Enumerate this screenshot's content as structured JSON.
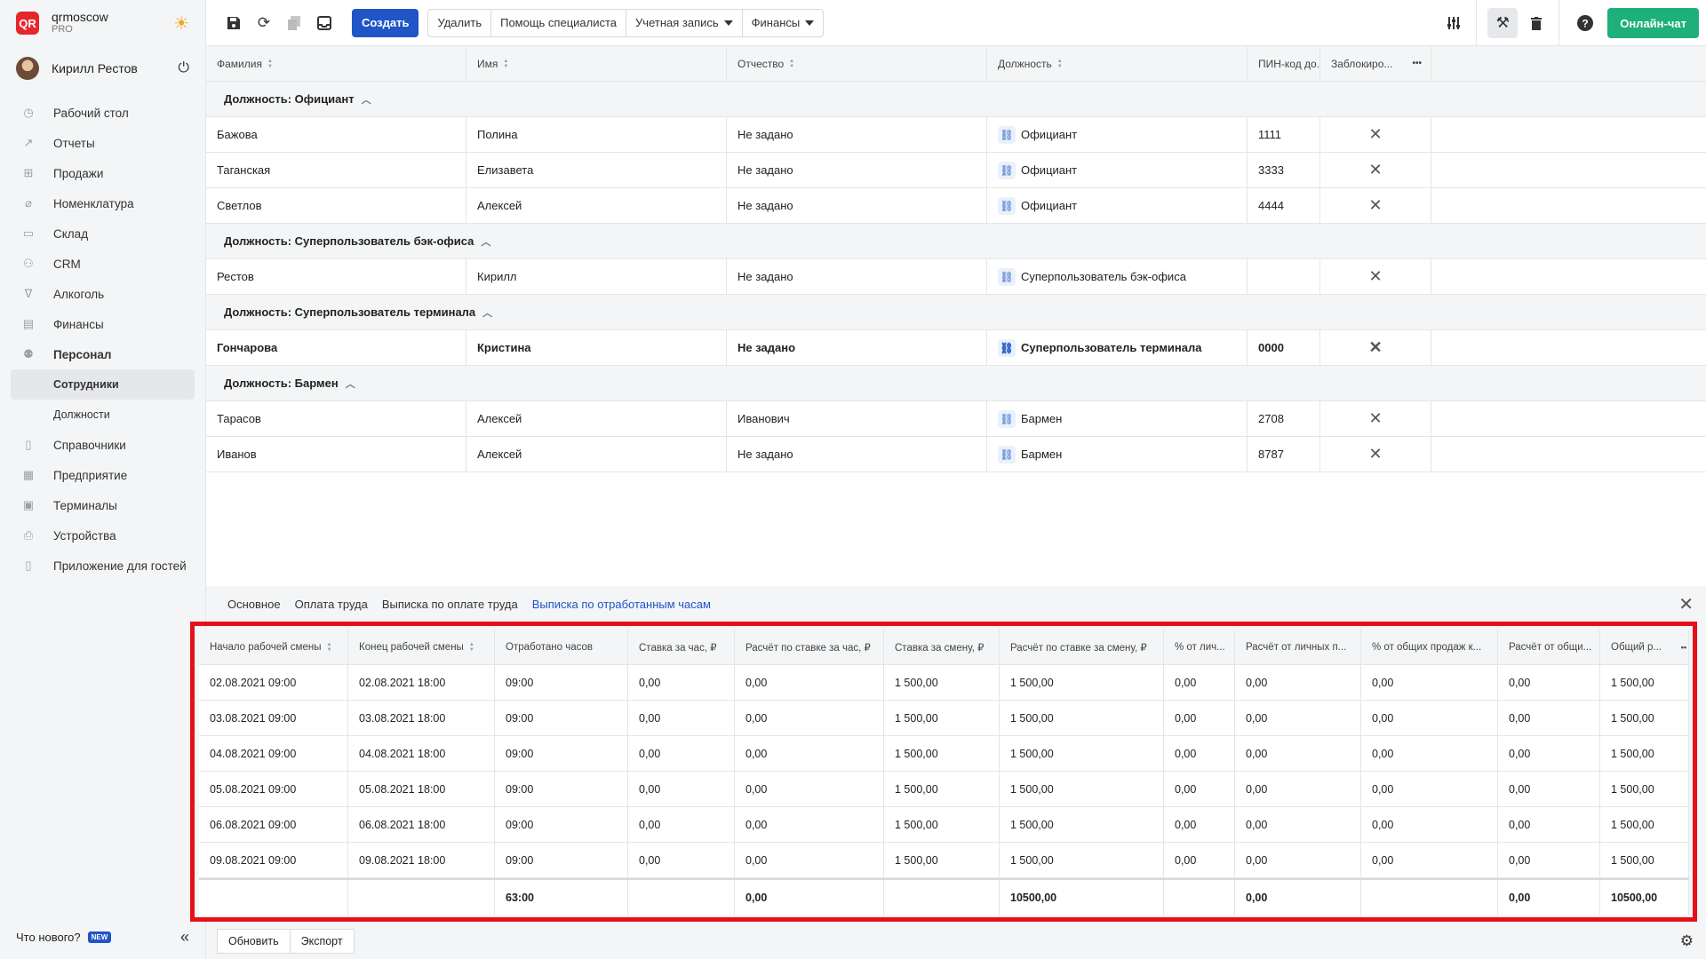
{
  "brand": {
    "name": "qrmoscow",
    "plan": "PRO",
    "logo": "QR"
  },
  "user": {
    "name": "Кирилл Рестов"
  },
  "nav": [
    {
      "label": "Рабочий стол",
      "icon": "dashboard-icon"
    },
    {
      "label": "Отчеты",
      "icon": "chart-icon"
    },
    {
      "label": "Продажи",
      "icon": "basket-icon"
    },
    {
      "label": "Номенклатура",
      "icon": "tag-icon"
    },
    {
      "label": "Склад",
      "icon": "box-icon"
    },
    {
      "label": "CRM",
      "icon": "users-icon"
    },
    {
      "label": "Алкоголь",
      "icon": "glass-icon"
    },
    {
      "label": "Финансы",
      "icon": "wallet-icon"
    },
    {
      "label": "Персонал",
      "icon": "people-icon"
    }
  ],
  "nav_sub": [
    "Сотрудники",
    "Должности"
  ],
  "nav_after": [
    {
      "label": "Справочники",
      "icon": "book-icon"
    },
    {
      "label": "Предприятие",
      "icon": "building-icon"
    },
    {
      "label": "Терминалы",
      "icon": "terminal-icon"
    },
    {
      "label": "Устройства",
      "icon": "printer-icon"
    },
    {
      "label": "Приложение для гостей",
      "icon": "phone-icon"
    }
  ],
  "sidebar_footer": {
    "whats_new": "Что нового?",
    "badge": "NEW"
  },
  "toolbar": {
    "create": "Создать",
    "delete": "Удалить",
    "help": "Помощь специалиста",
    "account": "Учетная запись",
    "finance": "Финансы",
    "chat": "Онлайн-чат"
  },
  "main_columns": [
    "Фамилия",
    "Имя",
    "Отчество",
    "Должность",
    "ПИН-код до...",
    "Заблокиро..."
  ],
  "groups": [
    {
      "title": "Должность: Официант",
      "rows": [
        {
          "last": "Бажова",
          "first": "Полина",
          "middle": "Не задано",
          "role": "Официант",
          "pin": "1111"
        },
        {
          "last": "Таганская",
          "first": "Елизавета",
          "middle": "Не задано",
          "role": "Официант",
          "pin": "3333"
        },
        {
          "last": "Светлов",
          "first": "Алексей",
          "middle": "Не задано",
          "role": "Официант",
          "pin": "4444"
        }
      ]
    },
    {
      "title": "Должность: Суперпользователь бэк-офиса",
      "rows": [
        {
          "last": "Рестов",
          "first": "Кирилл",
          "middle": "Не задано",
          "role": "Суперпользователь бэк-офиса",
          "pin": ""
        }
      ]
    },
    {
      "title": "Должность: Суперпользователь терминала",
      "rows": [
        {
          "last": "Гончарова",
          "first": "Кристина",
          "middle": "Не задано",
          "role": "Суперпользователь терминала",
          "pin": "0000"
        }
      ]
    },
    {
      "title": "Должность: Бармен",
      "rows": [
        {
          "last": "Тарасов",
          "first": "Алексей",
          "middle": "Иванович",
          "role": "Бармен",
          "pin": "2708"
        },
        {
          "last": "Иванов",
          "first": "Алексей",
          "middle": "Не задано",
          "role": "Бармен",
          "pin": "8787"
        }
      ]
    }
  ],
  "bottom_tabs": [
    "Основное",
    "Оплата труда",
    "Выписка по оплате труда",
    "Выписка по отработанным часам"
  ],
  "active_tab": 3,
  "sub_columns": [
    "Начало рабочей смены",
    "Конец рабочей смены",
    "Отработано часов",
    "Ставка за час, ₽",
    "Расчёт по ставке за час, ₽",
    "Ставка за смену, ₽",
    "Расчёт по ставке за смену, ₽",
    "% от лич...",
    "Расчёт от личных п...",
    "% от общих продаж к...",
    "Расчёт от общи...",
    "Общий р..."
  ],
  "sub_rows": [
    [
      "02.08.2021 09:00",
      "02.08.2021 18:00",
      "09:00",
      "0,00",
      "0,00",
      "1 500,00",
      "1 500,00",
      "0,00",
      "0,00",
      "0,00",
      "0,00",
      "1 500,00"
    ],
    [
      "03.08.2021 09:00",
      "03.08.2021 18:00",
      "09:00",
      "0,00",
      "0,00",
      "1 500,00",
      "1 500,00",
      "0,00",
      "0,00",
      "0,00",
      "0,00",
      "1 500,00"
    ],
    [
      "04.08.2021 09:00",
      "04.08.2021 18:00",
      "09:00",
      "0,00",
      "0,00",
      "1 500,00",
      "1 500,00",
      "0,00",
      "0,00",
      "0,00",
      "0,00",
      "1 500,00"
    ],
    [
      "05.08.2021 09:00",
      "05.08.2021 18:00",
      "09:00",
      "0,00",
      "0,00",
      "1 500,00",
      "1 500,00",
      "0,00",
      "0,00",
      "0,00",
      "0,00",
      "1 500,00"
    ],
    [
      "06.08.2021 09:00",
      "06.08.2021 18:00",
      "09:00",
      "0,00",
      "0,00",
      "1 500,00",
      "1 500,00",
      "0,00",
      "0,00",
      "0,00",
      "0,00",
      "1 500,00"
    ],
    [
      "09.08.2021 09:00",
      "09.08.2021 18:00",
      "09:00",
      "0,00",
      "0,00",
      "1 500,00",
      "1 500,00",
      "0,00",
      "0,00",
      "0,00",
      "0,00",
      "1 500,00"
    ]
  ],
  "sub_totals": [
    "",
    "",
    "63:00",
    "",
    "0,00",
    "",
    "10500,00",
    "",
    "0,00",
    "",
    "0,00",
    "10500,00"
  ],
  "footer": {
    "refresh": "Обновить",
    "export": "Экспорт"
  },
  "colors": {
    "accent": "#1f55c6",
    "chat": "#1db07a",
    "highlight": "#e3121a",
    "logo": "#e5262d"
  }
}
